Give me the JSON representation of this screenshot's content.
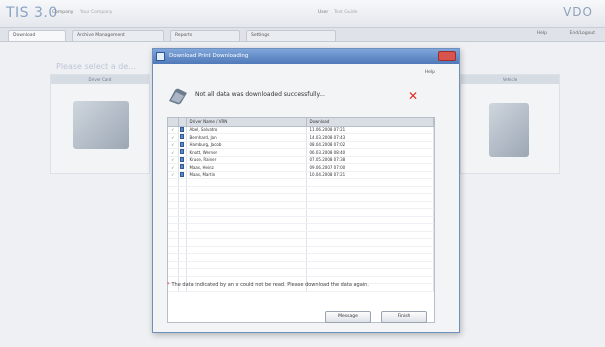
{
  "app": {
    "brand": "TIS 3.0",
    "company_label": "Company",
    "company_value": "Your Company",
    "user_label": "User",
    "user_value": "Test Guide",
    "vendor_logo": "VDO",
    "tabs": [
      {
        "label": "Download",
        "active": true
      },
      {
        "label": "Archive Management",
        "active": false
      },
      {
        "label": "Reports",
        "active": false
      },
      {
        "label": "Settings",
        "active": false
      }
    ],
    "help_label": "Help",
    "end_label": "End/Logout",
    "background_title": "Please select a de...",
    "card_left_head": "Driver Card",
    "card_right_head": "Vehicle"
  },
  "dialog": {
    "title": "Download Print Downloading",
    "help_label": "Help",
    "message": "Not all data was downloaded successfully...",
    "columns": [
      "",
      "",
      "Driver Name / VRN",
      "Download"
    ],
    "rows": [
      {
        "check": "✓",
        "name": "Abel, Salvatro",
        "date": "11.06.2008 07:21"
      },
      {
        "check": "✓",
        "name": "Bernhard, Jan",
        "date": "14.03.2008 07:43"
      },
      {
        "check": "✓",
        "name": "Hamburg, Jacob",
        "date": "08.04.2008 07:02"
      },
      {
        "check": "✓",
        "name": "Knott, Werner",
        "date": "06.03.2008 08:40"
      },
      {
        "check": "✓",
        "name": "Kruse, Rainer",
        "date": "07.05.2008 07:38"
      },
      {
        "check": "✓",
        "name": "Maas, Heinz",
        "date": "09.06.2007 07:00"
      },
      {
        "check": "✓",
        "name": "Maas, Martin",
        "date": "10.04.2008 07:21"
      }
    ],
    "empty_rows": 15,
    "note_star": "*",
    "note": "The data indicated by an x could not be read. Please download the data again.",
    "buttons": {
      "message": "Message",
      "finish": "Finish"
    },
    "colors": {
      "title_bar": "#4e78b8",
      "error_x": "#e02b20",
      "check": "#2b7a2b"
    }
  }
}
